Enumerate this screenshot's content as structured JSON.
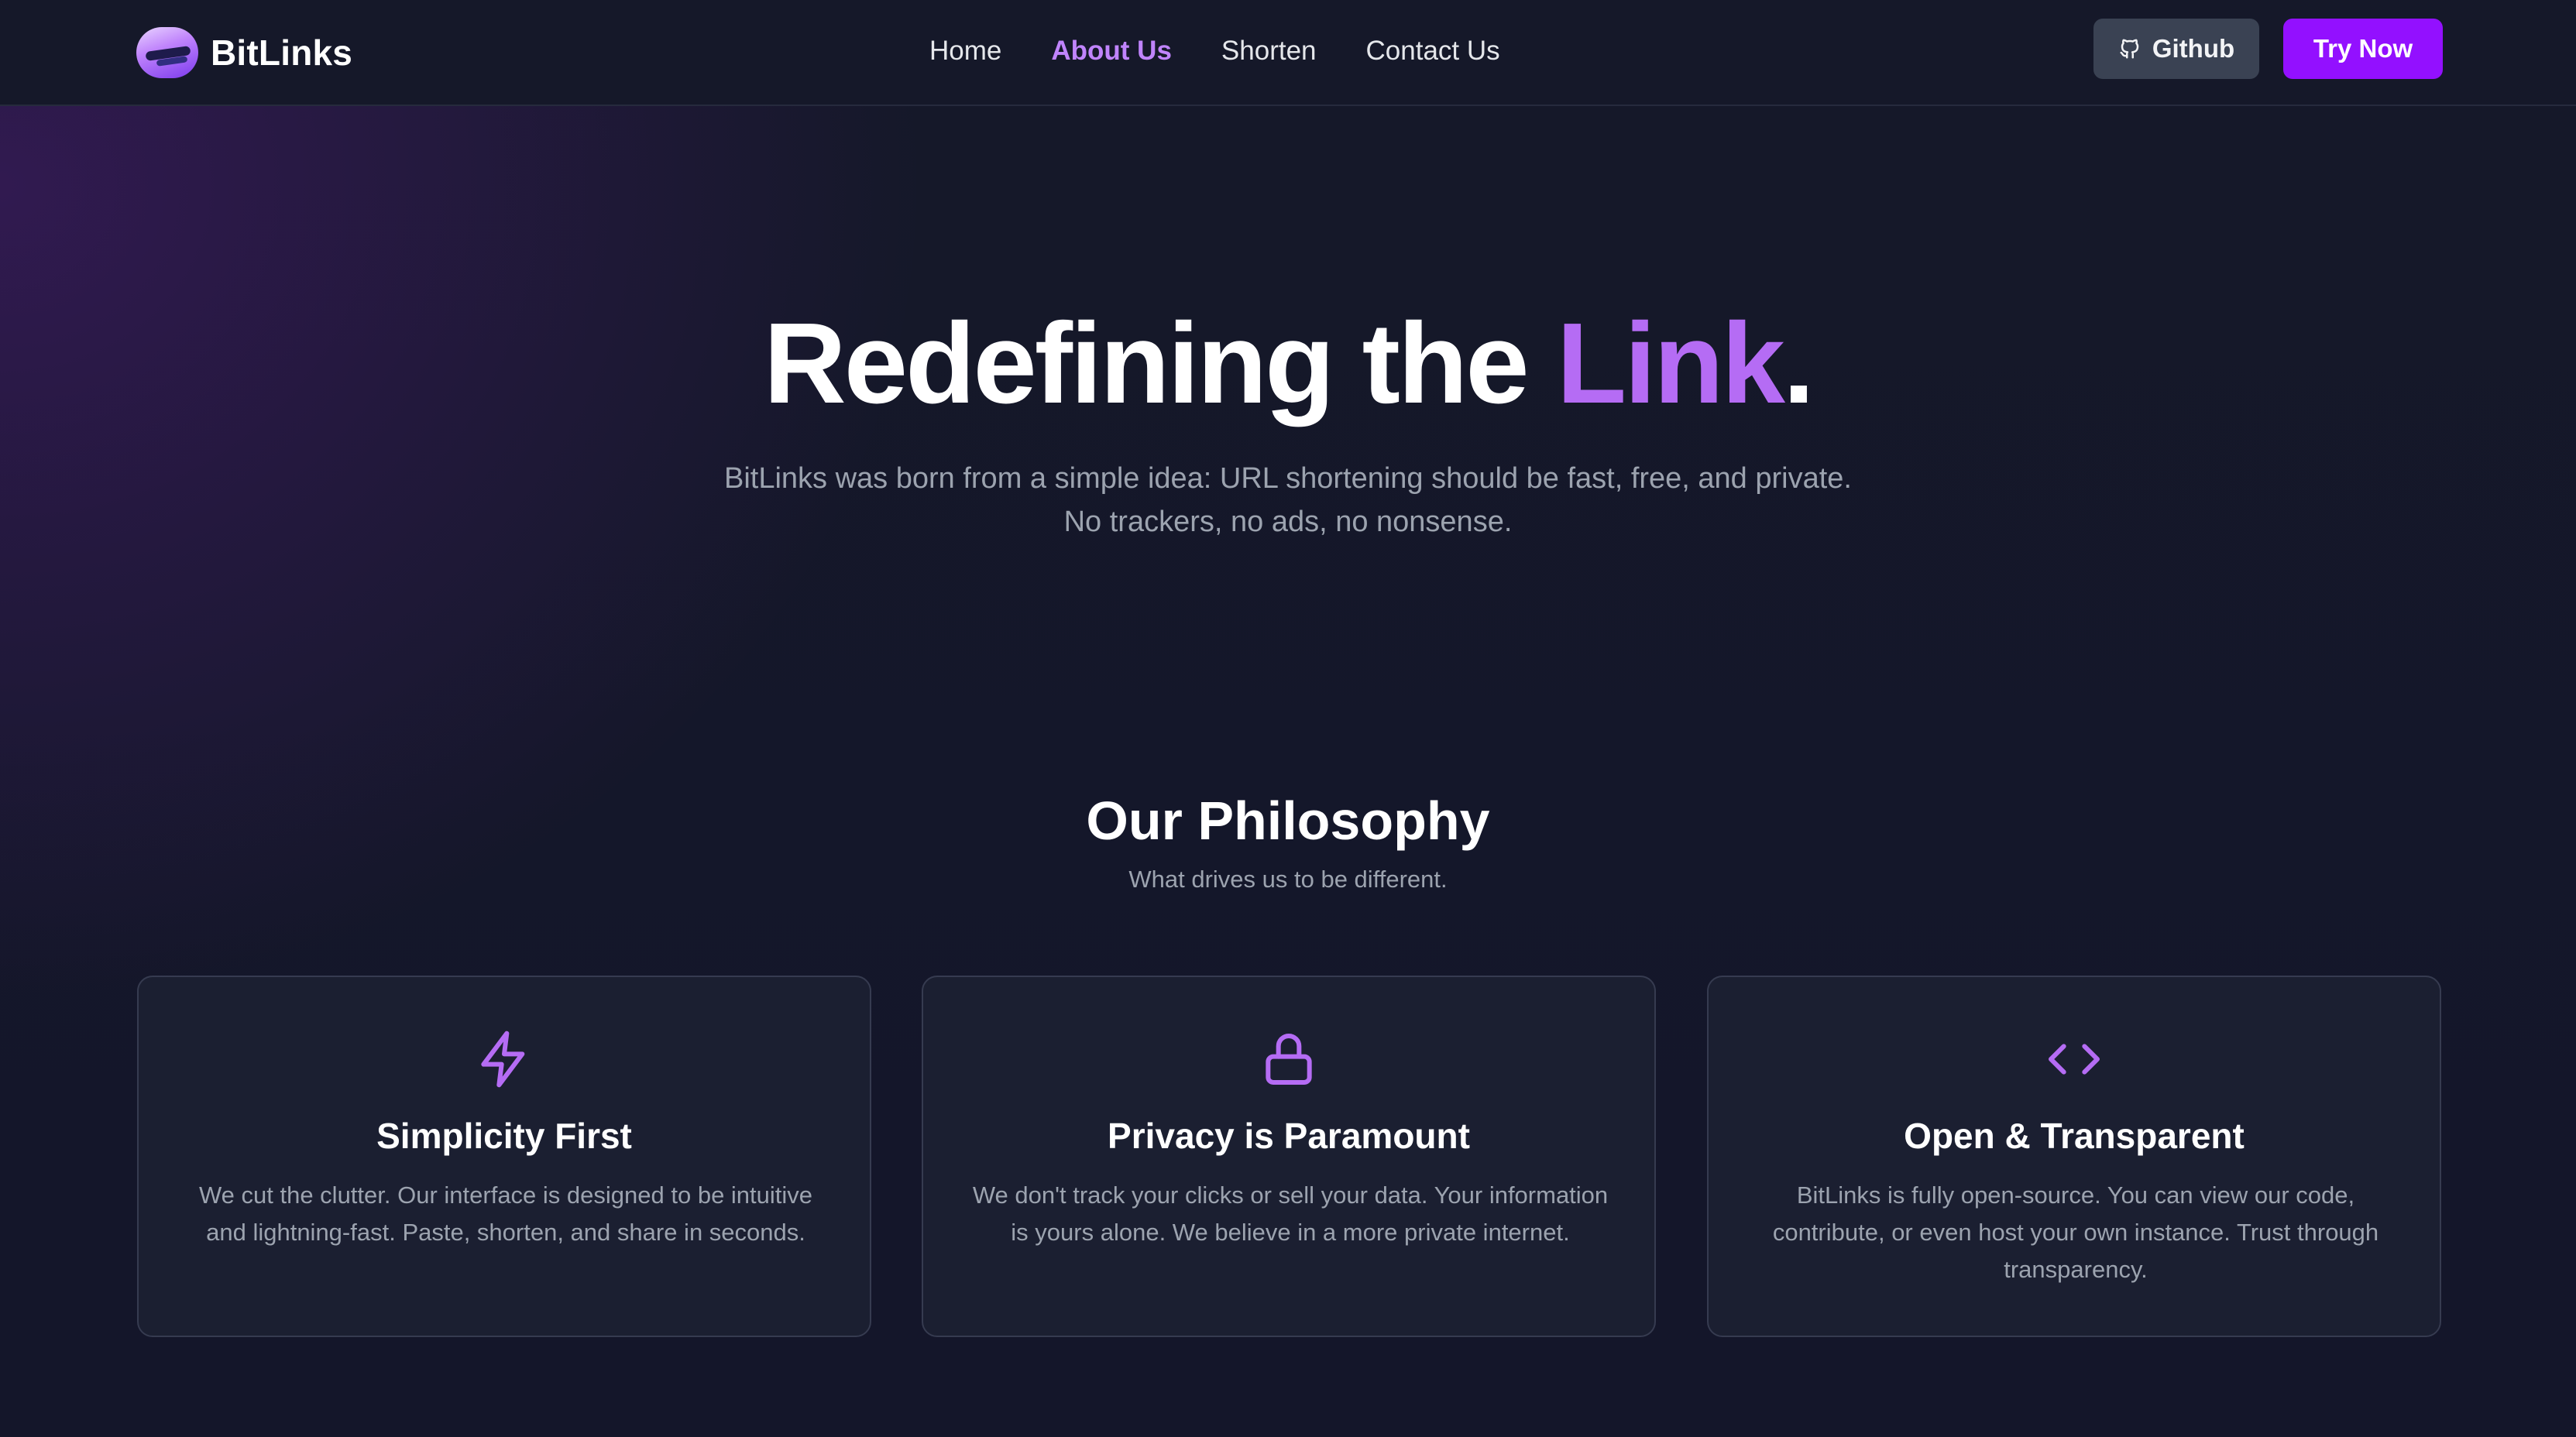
{
  "header": {
    "brand": "BitLinks",
    "nav": [
      {
        "label": "Home",
        "active": false
      },
      {
        "label": "About Us",
        "active": true
      },
      {
        "label": "Shorten",
        "active": false
      },
      {
        "label": "Contact Us",
        "active": false
      }
    ],
    "github_label": "Github",
    "try_label": "Try Now"
  },
  "hero": {
    "title_main": "Redefining the ",
    "title_accent": "Link",
    "title_end": ".",
    "subtitle_line1": "BitLinks was born from a simple idea: URL shortening should be fast, free, and private.",
    "subtitle_line2": "No trackers, no ads, no nonsense."
  },
  "philosophy": {
    "title": "Our Philosophy",
    "subtitle": "What drives us to be different.",
    "cards": [
      {
        "icon": "lightning-icon",
        "title": "Simplicity First",
        "text": "We cut the clutter. Our interface is designed to be intuitive and lightning-fast. Paste, shorten, and share in seconds."
      },
      {
        "icon": "lock-icon",
        "title": "Privacy is Paramount",
        "text": "We don't track your clicks or sell your data. Your information is yours alone. We believe in a more private internet."
      },
      {
        "icon": "code-icon",
        "title": "Open & Transparent",
        "text": "BitLinks is fully open-source. You can view our code, contribute, or even host your own instance. Trust through transparency."
      }
    ]
  },
  "colors": {
    "accent": "#b56cf4",
    "button_primary": "#9310ff",
    "button_secondary": "#3a4253",
    "background": "#14172a"
  }
}
